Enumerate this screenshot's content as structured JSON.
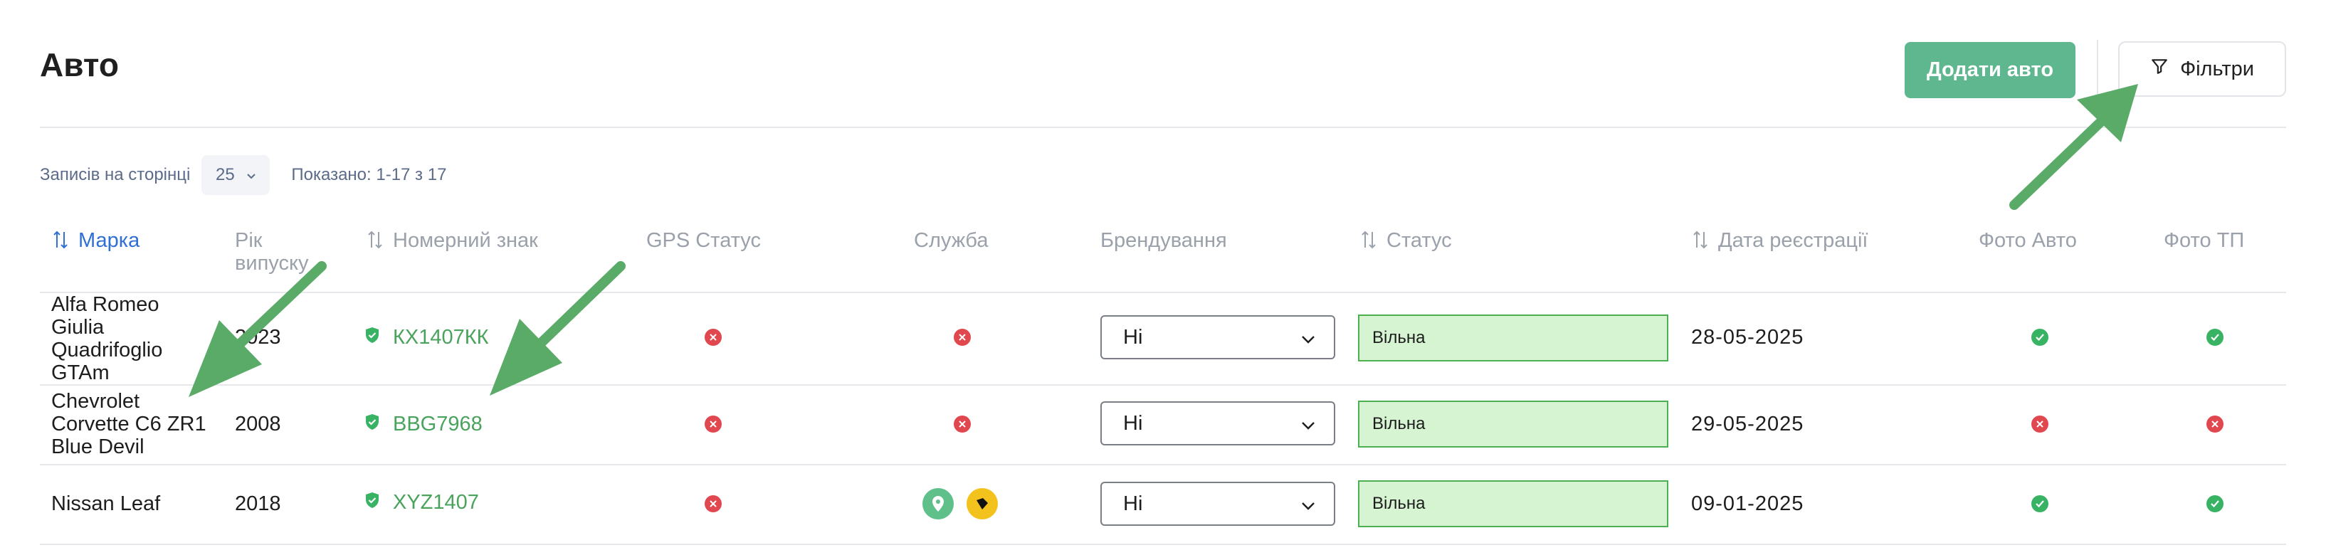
{
  "header": {
    "title": "Авто",
    "add_button": "Додати авто",
    "filters_button": "Фільтри",
    "filter_icon": "funnel-icon"
  },
  "pagination": {
    "per_page_label": "Записів на сторінці",
    "per_page_value": "25",
    "shown_text": "Показано: 1-17 з 17"
  },
  "table": {
    "columns": [
      {
        "label": "Марка",
        "sortable": true,
        "active": true
      },
      {
        "label": "Рік випуску",
        "sortable": false
      },
      {
        "label": "Номерний знак",
        "sortable": true
      },
      {
        "label": "GPS Статус",
        "sortable": false
      },
      {
        "label": "Служба",
        "sortable": false
      },
      {
        "label": "Брендування",
        "sortable": false
      },
      {
        "label": "Статус",
        "sortable": true
      },
      {
        "label": "Дата реєстрації",
        "sortable": true
      },
      {
        "label": "Фото Авто",
        "sortable": false
      },
      {
        "label": "Фото ТП",
        "sortable": false
      }
    ],
    "rows": [
      {
        "brand": [
          "Alfa Romeo",
          "Giulia",
          "Quadrifoglio",
          "GTAm"
        ],
        "year": "2023",
        "plate": "КХ1407КК",
        "gps_status": "error",
        "service": "error",
        "branding": "Ні",
        "status": "Вільна",
        "registered": "28-05-2025",
        "photo_car": "ok",
        "photo_tp": "ok"
      },
      {
        "brand": [
          "Chevrolet",
          "Corvette C6 ZR1",
          "Blue Devil"
        ],
        "year": "2008",
        "plate": "BBG7968",
        "gps_status": "error",
        "service": "error",
        "branding": "Ні",
        "status": "Вільна",
        "registered": "29-05-2025",
        "photo_car": "error",
        "photo_tp": "error"
      },
      {
        "brand": [
          "Nissan Leaf"
        ],
        "year": "2018",
        "plate": "XYZ1407",
        "gps_status": "error",
        "service": "icons",
        "service_icons": [
          "location-pin-icon",
          "shield-logo-icon"
        ],
        "branding": "Ні",
        "status": "Вільна",
        "registered": "09-01-2025",
        "photo_car": "ok",
        "photo_tp": "ok"
      }
    ]
  },
  "colors": {
    "accent_green": "#5fb78f",
    "link_green": "#4aa35c",
    "status_bg": "#d6f4d2",
    "status_border": "#4caf50",
    "error_red": "#e0474f",
    "ok_green": "#38b263",
    "active_blue": "#2f6fd6",
    "annotation_arrow": "#5aaa68"
  }
}
